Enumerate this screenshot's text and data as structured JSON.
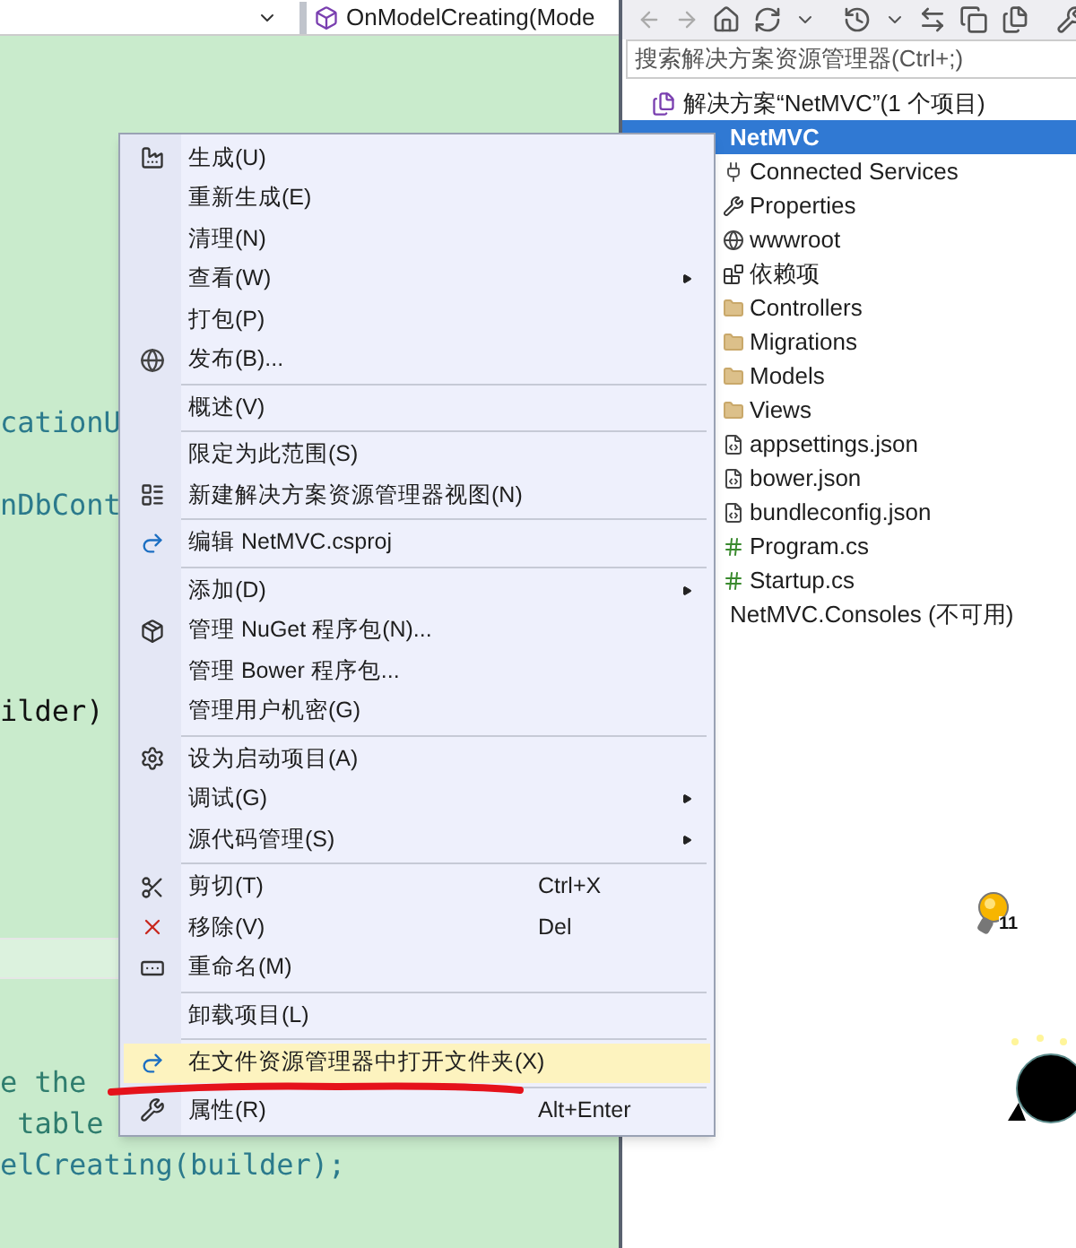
{
  "editor": {
    "member_dropdown": {
      "label": "OnModelCreating(Mode"
    },
    "code_lines": [
      {
        "text": "cationU",
        "kind": "type"
      },
      {
        "text": "nDbCont",
        "kind": "type"
      },
      {
        "text": "ilder)",
        "kind": "plain"
      },
      {
        "text": "e the",
        "kind": "comment"
      },
      {
        "text": " table",
        "kind": "comment"
      },
      {
        "text": "elCreating(builder);",
        "kind": "type"
      }
    ]
  },
  "context_menu": {
    "items": [
      {
        "kind": "item",
        "label": "生成(U)",
        "selected": false
      },
      {
        "kind": "item",
        "label": "重新生成(E)",
        "selected": false
      },
      {
        "kind": "item",
        "label": "清理(N)",
        "selected": false
      },
      {
        "kind": "item",
        "label": "查看(W)",
        "submenu": true,
        "selected": false
      },
      {
        "kind": "item",
        "label": "打包(P)",
        "selected": false
      },
      {
        "kind": "item",
        "label": "发布(B)...",
        "selected": false
      },
      {
        "kind": "separator"
      },
      {
        "kind": "item",
        "label": "概述(V)",
        "selected": false
      },
      {
        "kind": "separator"
      },
      {
        "kind": "item",
        "label": "限定为此范围(S)",
        "selected": false
      },
      {
        "kind": "item",
        "label": "新建解决方案资源管理器视图(N)",
        "selected": false
      },
      {
        "kind": "separator"
      },
      {
        "kind": "item",
        "label": "编辑 NetMVC.csproj",
        "selected": false
      },
      {
        "kind": "separator"
      },
      {
        "kind": "item",
        "label": "添加(D)",
        "submenu": true,
        "selected": false
      },
      {
        "kind": "item",
        "label": "管理 NuGet 程序包(N)...",
        "selected": false
      },
      {
        "kind": "item",
        "label": "管理 Bower 程序包...",
        "selected": false
      },
      {
        "kind": "item",
        "label": "管理用户机密(G)",
        "selected": false
      },
      {
        "kind": "separator"
      },
      {
        "kind": "item",
        "label": "设为启动项目(A)",
        "selected": false
      },
      {
        "kind": "item",
        "label": "调试(G)",
        "submenu": true,
        "selected": false
      },
      {
        "kind": "item",
        "label": "源代码管理(S)",
        "submenu": true,
        "selected": false
      },
      {
        "kind": "separator"
      },
      {
        "kind": "item",
        "label": "剪切(T)",
        "shortcut": "Ctrl+X",
        "selected": false
      },
      {
        "kind": "item",
        "label": "移除(V)",
        "shortcut": "Del",
        "selected": false
      },
      {
        "kind": "item",
        "label": "重命名(M)",
        "selected": false
      },
      {
        "kind": "separator"
      },
      {
        "kind": "item",
        "label": "卸载项目(L)",
        "selected": false
      },
      {
        "kind": "separator"
      },
      {
        "kind": "item",
        "label": "在文件资源管理器中打开文件夹(X)",
        "selected": true
      },
      {
        "kind": "separator"
      },
      {
        "kind": "item",
        "label": "属性(R)",
        "shortcut": "Alt+Enter",
        "selected": false
      }
    ]
  },
  "solution_explorer": {
    "search": {
      "placeholder": "搜索解决方案资源管理器(Ctrl+;)"
    },
    "solution": {
      "label": "解决方案“NetMVC”(1 个项目)"
    },
    "project": {
      "label": "NetMVC",
      "selected": true
    },
    "items": [
      {
        "kind": "service",
        "label": "Connected Services"
      },
      {
        "kind": "settings",
        "label": "Properties"
      },
      {
        "kind": "web",
        "label": "wwwroot"
      },
      {
        "kind": "dependencies",
        "label": "依赖项"
      },
      {
        "kind": "folder",
        "label": "Controllers"
      },
      {
        "kind": "folder",
        "label": "Migrations"
      },
      {
        "kind": "folder",
        "label": "Models"
      },
      {
        "kind": "folder",
        "label": "Views"
      },
      {
        "kind": "json",
        "label": "appsettings.json"
      },
      {
        "kind": "json",
        "label": "bower.json"
      },
      {
        "kind": "json",
        "label": "bundleconfig.json"
      },
      {
        "kind": "csharp",
        "label": "Program.cs"
      },
      {
        "kind": "csharp",
        "label": "Startup.cs"
      }
    ],
    "unavailable_project": {
      "label": "NetMVC.Consoles (不可用)"
    },
    "lightbulb_count": "11"
  }
}
